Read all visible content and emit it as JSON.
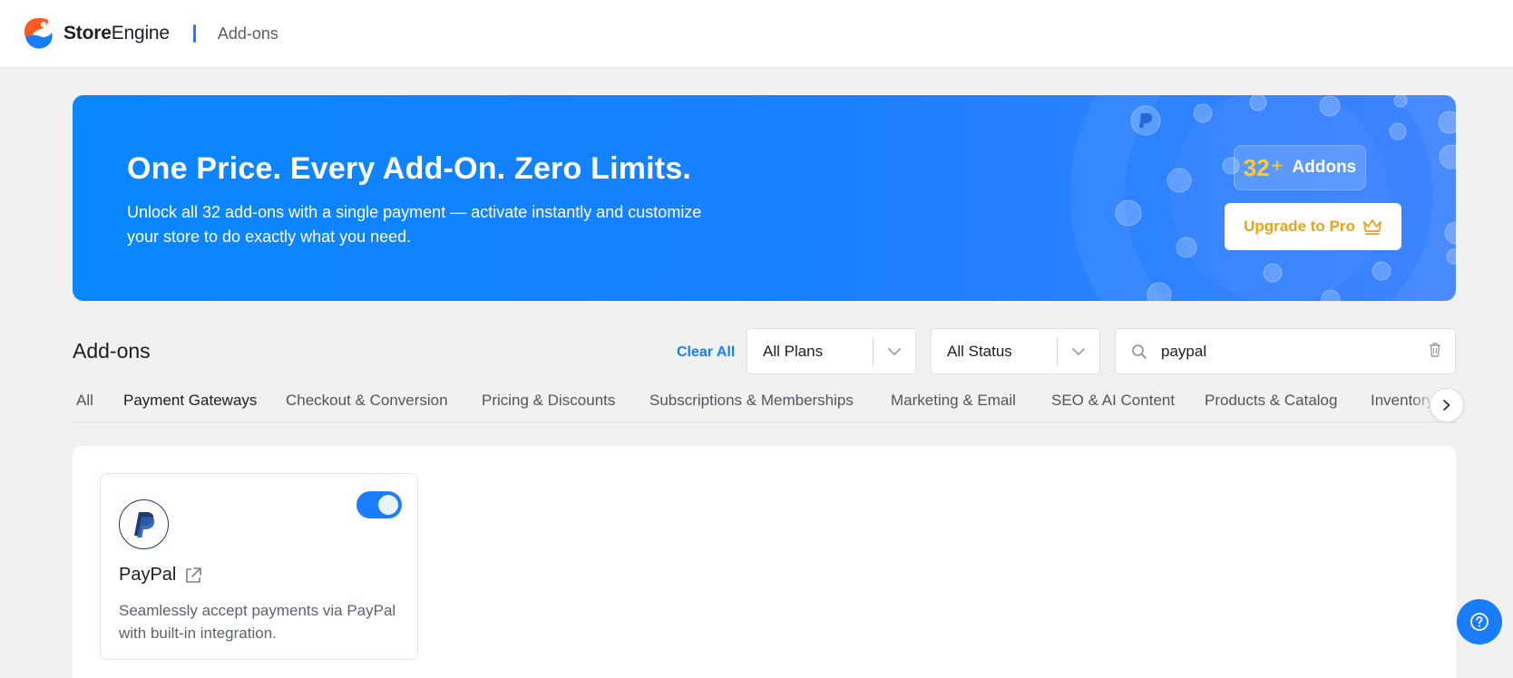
{
  "header": {
    "brand_bold": "Store",
    "brand_rest": "Engine",
    "page": "Add-ons"
  },
  "hero": {
    "title": "One Price. Every Add-On. Zero Limits.",
    "subtitle": "Unlock all 32 add-ons with a single payment — activate instantly and customize your store to do exactly what you need.",
    "badge_count": "32",
    "badge_plus": "+",
    "badge_label": "Addons",
    "upgrade_label": "Upgrade to Pro"
  },
  "filters": {
    "section_title": "Add-ons",
    "clear_all": "Clear All",
    "plans_value": "All Plans",
    "status_value": "All Status",
    "search_value": "paypal"
  },
  "tabs": [
    {
      "label": "All",
      "active": false
    },
    {
      "label": "Payment Gateways",
      "active": true
    },
    {
      "label": "Checkout & Conversion",
      "active": false
    },
    {
      "label": "Pricing & Discounts",
      "active": false
    },
    {
      "label": "Subscriptions & Memberships",
      "active": false
    },
    {
      "label": "Marketing & Email",
      "active": false
    },
    {
      "label": "SEO & AI Content",
      "active": false
    },
    {
      "label": "Products & Catalog",
      "active": false
    },
    {
      "label": "Inventory",
      "active": false
    }
  ],
  "addons": [
    {
      "name": "PayPal",
      "description": "Seamlessly accept payments via PayPal with built-in integration.",
      "enabled": true
    }
  ],
  "colors": {
    "accent": "#1a7cff",
    "badge_gold": "#ffcc2e",
    "upgrade_text": "#e8a317"
  },
  "icons": {
    "logo": "storeengine-logo",
    "search": "search-icon",
    "clear": "trash-icon",
    "next": "chevron-right-icon",
    "external": "external-link-icon",
    "help": "help-icon"
  }
}
